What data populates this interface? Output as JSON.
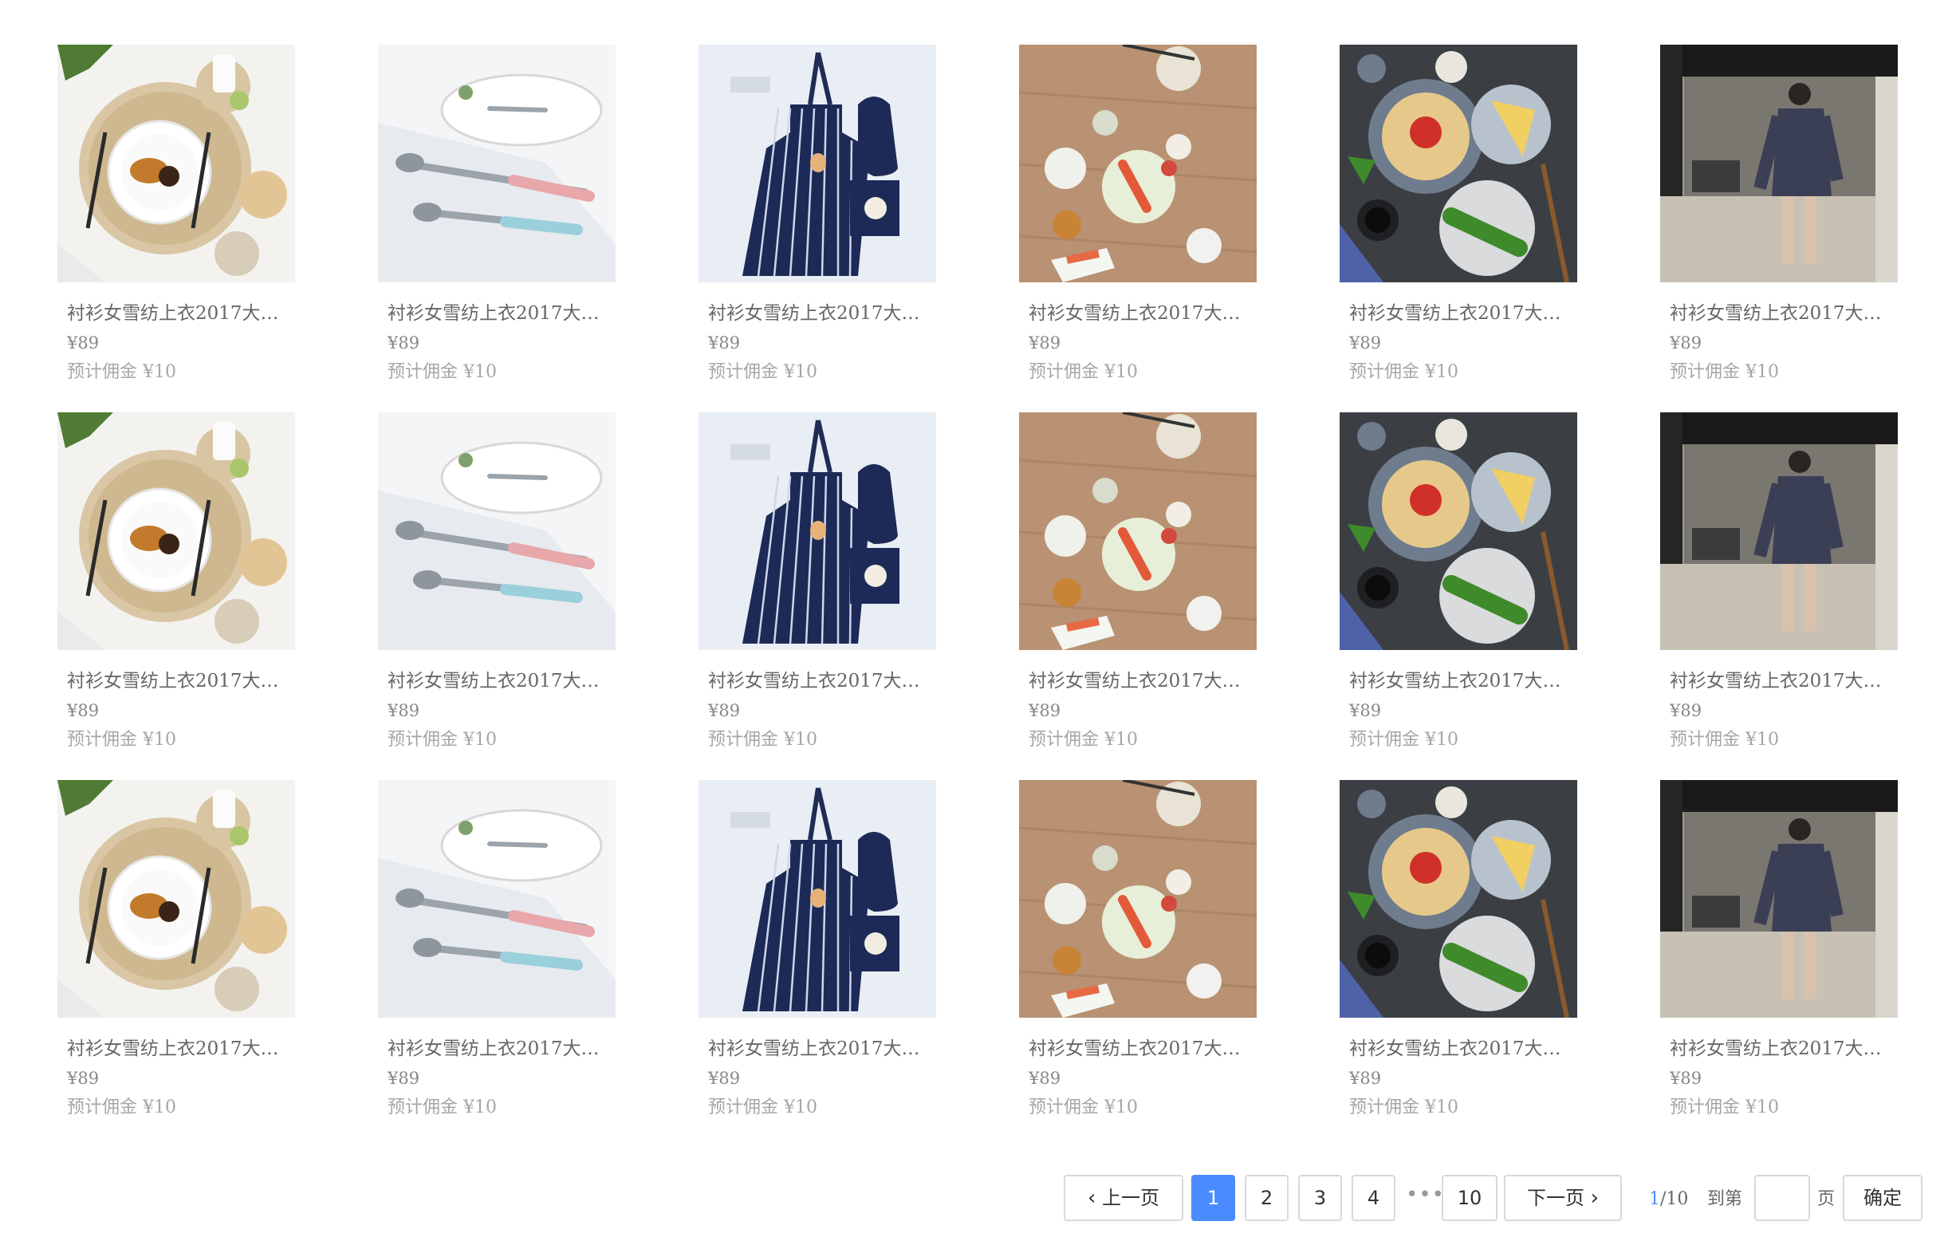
{
  "products": [
    {
      "image": "tableware-breakfast",
      "name": "衬衫女雪纺上衣2017大…",
      "price": "¥89",
      "commission": "预计佣金 ¥10"
    },
    {
      "image": "spoons-plate",
      "name": "衬衫女雪纺上衣2017大…",
      "price": "¥89",
      "commission": "预计佣金 ¥10"
    },
    {
      "image": "apron-mitt",
      "name": "衬衫女雪纺上衣2017大…",
      "price": "¥89",
      "commission": "预计佣金 ¥10"
    },
    {
      "image": "tea-set-wood",
      "name": "衬衫女雪纺上衣2017大…",
      "price": "¥89",
      "commission": "预计佣金 ¥10"
    },
    {
      "image": "food-dishes",
      "name": "衬衫女雪纺上衣2017大…",
      "price": "¥89",
      "commission": "预计佣金 ¥10"
    },
    {
      "image": "fashion-model",
      "name": "衬衫女雪纺上衣2017大…",
      "price": "¥89",
      "commission": "预计佣金 ¥10"
    },
    {
      "image": "tableware-breakfast",
      "name": "衬衫女雪纺上衣2017大…",
      "price": "¥89",
      "commission": "预计佣金 ¥10"
    },
    {
      "image": "spoons-plate",
      "name": "衬衫女雪纺上衣2017大…",
      "price": "¥89",
      "commission": "预计佣金 ¥10"
    },
    {
      "image": "apron-mitt",
      "name": "衬衫女雪纺上衣2017大…",
      "price": "¥89",
      "commission": "预计佣金 ¥10"
    },
    {
      "image": "tea-set-wood",
      "name": "衬衫女雪纺上衣2017大…",
      "price": "¥89",
      "commission": "预计佣金 ¥10"
    },
    {
      "image": "food-dishes",
      "name": "衬衫女雪纺上衣2017大…",
      "price": "¥89",
      "commission": "预计佣金 ¥10"
    },
    {
      "image": "fashion-model",
      "name": "衬衫女雪纺上衣2017大…",
      "price": "¥89",
      "commission": "预计佣金 ¥10"
    },
    {
      "image": "tableware-breakfast",
      "name": "衬衫女雪纺上衣2017大…",
      "price": "¥89",
      "commission": "预计佣金 ¥10"
    },
    {
      "image": "spoons-plate",
      "name": "衬衫女雪纺上衣2017大…",
      "price": "¥89",
      "commission": "预计佣金 ¥10"
    },
    {
      "image": "apron-mitt",
      "name": "衬衫女雪纺上衣2017大…",
      "price": "¥89",
      "commission": "预计佣金 ¥10"
    },
    {
      "image": "tea-set-wood",
      "name": "衬衫女雪纺上衣2017大…",
      "price": "¥89",
      "commission": "预计佣金 ¥10"
    },
    {
      "image": "food-dishes",
      "name": "衬衫女雪纺上衣2017大…",
      "price": "¥89",
      "commission": "预计佣金 ¥10"
    },
    {
      "image": "fashion-model",
      "name": "衬衫女雪纺上衣2017大…",
      "price": "¥89",
      "commission": "预计佣金 ¥10"
    }
  ],
  "pagination": {
    "prev_label": "上一页",
    "pages": [
      "1",
      "2",
      "3",
      "4"
    ],
    "ellipsis": "•••",
    "last_page": "10",
    "next_label": "下一页",
    "current": "1",
    "total": "/10",
    "goto_label": "到第",
    "goto_value": "",
    "page_unit": "页",
    "confirm_label": "确定"
  },
  "colors": {
    "accent": "#4a8cff",
    "border": "#d9d9d9",
    "name_text": "#666666",
    "commission_text": "#a6a6a6"
  }
}
